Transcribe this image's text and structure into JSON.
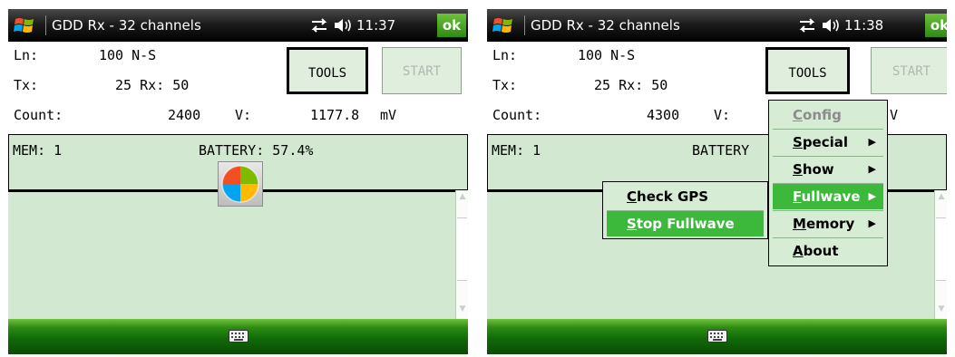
{
  "left": {
    "titlebar": {
      "title": "GDD Rx - 32 channels",
      "time": "11:37",
      "ok_label": "ok"
    },
    "info": {
      "ln_label": "Ln:",
      "ln_value": "100 N-S",
      "tx_label": "Tx:",
      "tx_value": "25 Rx: 50",
      "count_label": "Count:",
      "count_value": "2400",
      "v_label": "V:",
      "v_value": "1177.8",
      "v_unit": "mV"
    },
    "buttons": {
      "tools": "TOOLS",
      "start": "START"
    },
    "status": {
      "mem": "MEM: 1",
      "battery": "BATTERY: 57.4%"
    }
  },
  "right": {
    "titlebar": {
      "title": "GDD Rx - 32 channels",
      "time": "11:38",
      "ok_label": "ok"
    },
    "info": {
      "ln_label": "Ln:",
      "ln_value": "100 N-S",
      "tx_label": "Tx:",
      "tx_value": "25 Rx: 50",
      "count_label": "Count:",
      "count_value": "4300",
      "v_label": "V:",
      "v_partial": "V"
    },
    "buttons": {
      "tools": "TOOLS",
      "start": "START"
    },
    "status": {
      "mem": "MEM: 1",
      "battery_partial": "BATTERY"
    },
    "tools_menu": {
      "items": [
        {
          "first": "C",
          "rest": "onfig",
          "disabled": true
        },
        {
          "first": "S",
          "rest": "pecial",
          "submenu": true
        },
        {
          "first": "S",
          "rest": "how",
          "submenu": true
        },
        {
          "first": "F",
          "rest": "ullwave",
          "submenu": true,
          "selected": true
        },
        {
          "first": "M",
          "rest": "emory",
          "submenu": true
        },
        {
          "first": "A",
          "rest": "bout"
        }
      ]
    },
    "fullwave_submenu": {
      "items": [
        {
          "first": "C",
          "rest": "heck GPS"
        },
        {
          "first": "S",
          "rest": "top Fullwave",
          "selected": true
        }
      ]
    }
  },
  "icons": {
    "windows_logo": "windows-flag-icon",
    "connectivity": "connectivity-arrows-icon",
    "volume": "speaker-volume-icon",
    "keyboard": "keyboard-icon",
    "start_menu": "windows-start-logo-icon"
  },
  "colors": {
    "screen_bg": "#d2e8d0",
    "menu_highlight": "#3cb83a",
    "bottom_bar": "#2c8a14",
    "ok_button": "#4ea828"
  }
}
